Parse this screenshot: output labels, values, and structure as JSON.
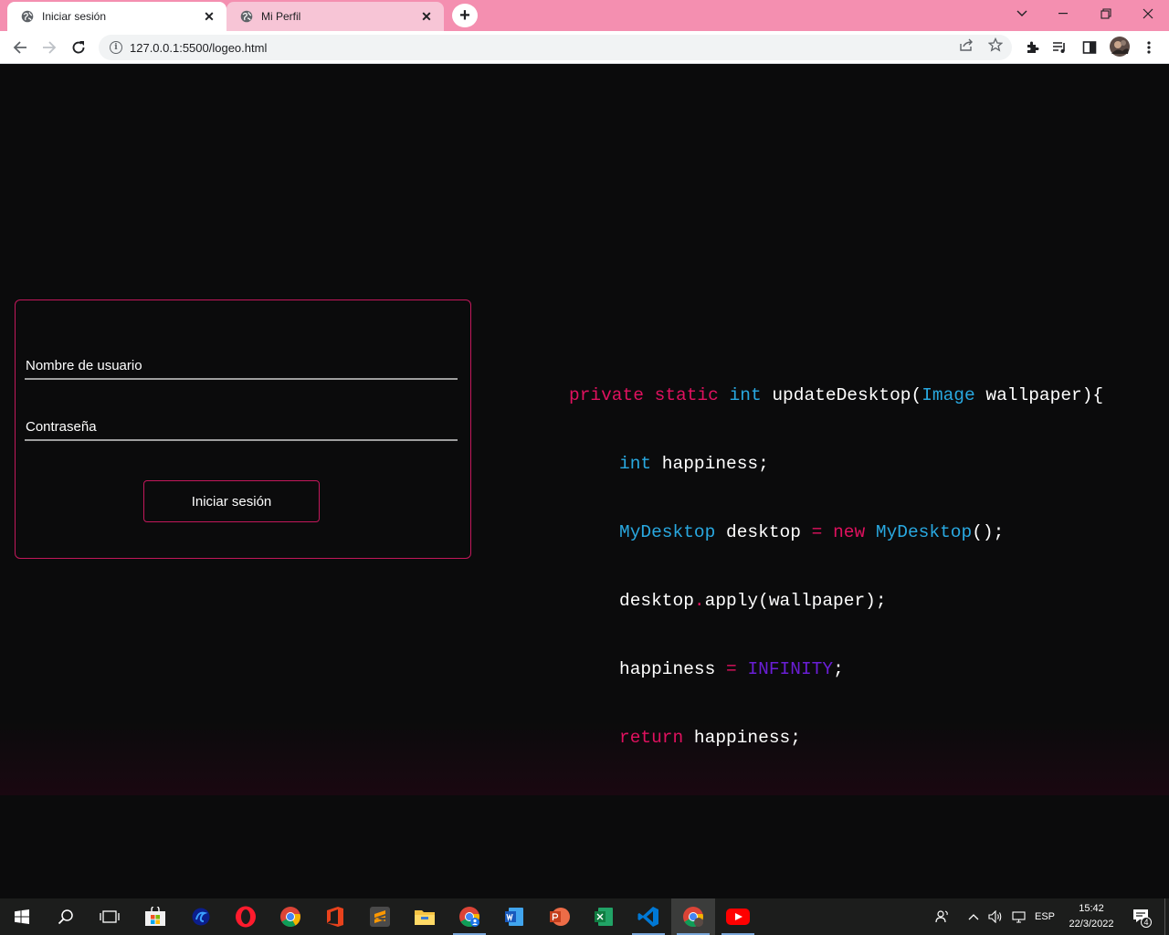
{
  "browser": {
    "tabs": [
      {
        "title": "Iniciar sesión",
        "active": true
      },
      {
        "title": "Mi Perfil",
        "active": false
      }
    ],
    "new_tab_label": "+",
    "url": "127.0.0.1:5500/logeo.html"
  },
  "login": {
    "username_label": "Nombre de usuario",
    "password_label": "Contraseña",
    "submit_label": "Iniciar sesión"
  },
  "code_block": {
    "line1": {
      "kw1": "private",
      "kw2": "static",
      "type1": "int",
      "fn": "updateDesktop(",
      "type2": "Image",
      "rest": " wallpaper){"
    },
    "line2": {
      "type": "int",
      "rest": " happiness;"
    },
    "line3": {
      "type1": "MyDesktop",
      "mid": " desktop ",
      "op": "=",
      "kw": "new",
      "type2": "MyDesktop",
      "rest": "();"
    },
    "line4": {
      "a": "desktop",
      "dot": ".",
      "b": "apply(wallpaper);"
    },
    "line5": {
      "a": "happiness ",
      "op": "=",
      "const": "INFINITY",
      "rest": ";"
    },
    "line6": {
      "kw": "return",
      "rest": " happiness;"
    },
    "line7": "}"
  },
  "taskbar": {
    "apps": [
      "windows-start",
      "search",
      "task-view",
      "microsoft-store",
      "edge-legacy",
      "opera",
      "chrome",
      "office",
      "sublime-text",
      "file-explorer",
      "chrome-profile",
      "word",
      "powerpoint",
      "excel",
      "vscode",
      "chrome-active",
      "youtube"
    ],
    "language": "ESP",
    "time": "15:42",
    "date": "22/3/2022",
    "notification_count": "4"
  },
  "colors": {
    "tab_strip": "#f48fb0",
    "accent_border": "#c2185b",
    "keyword": "#e0115f",
    "type": "#29a8e0",
    "constant": "#6a1ed6"
  }
}
